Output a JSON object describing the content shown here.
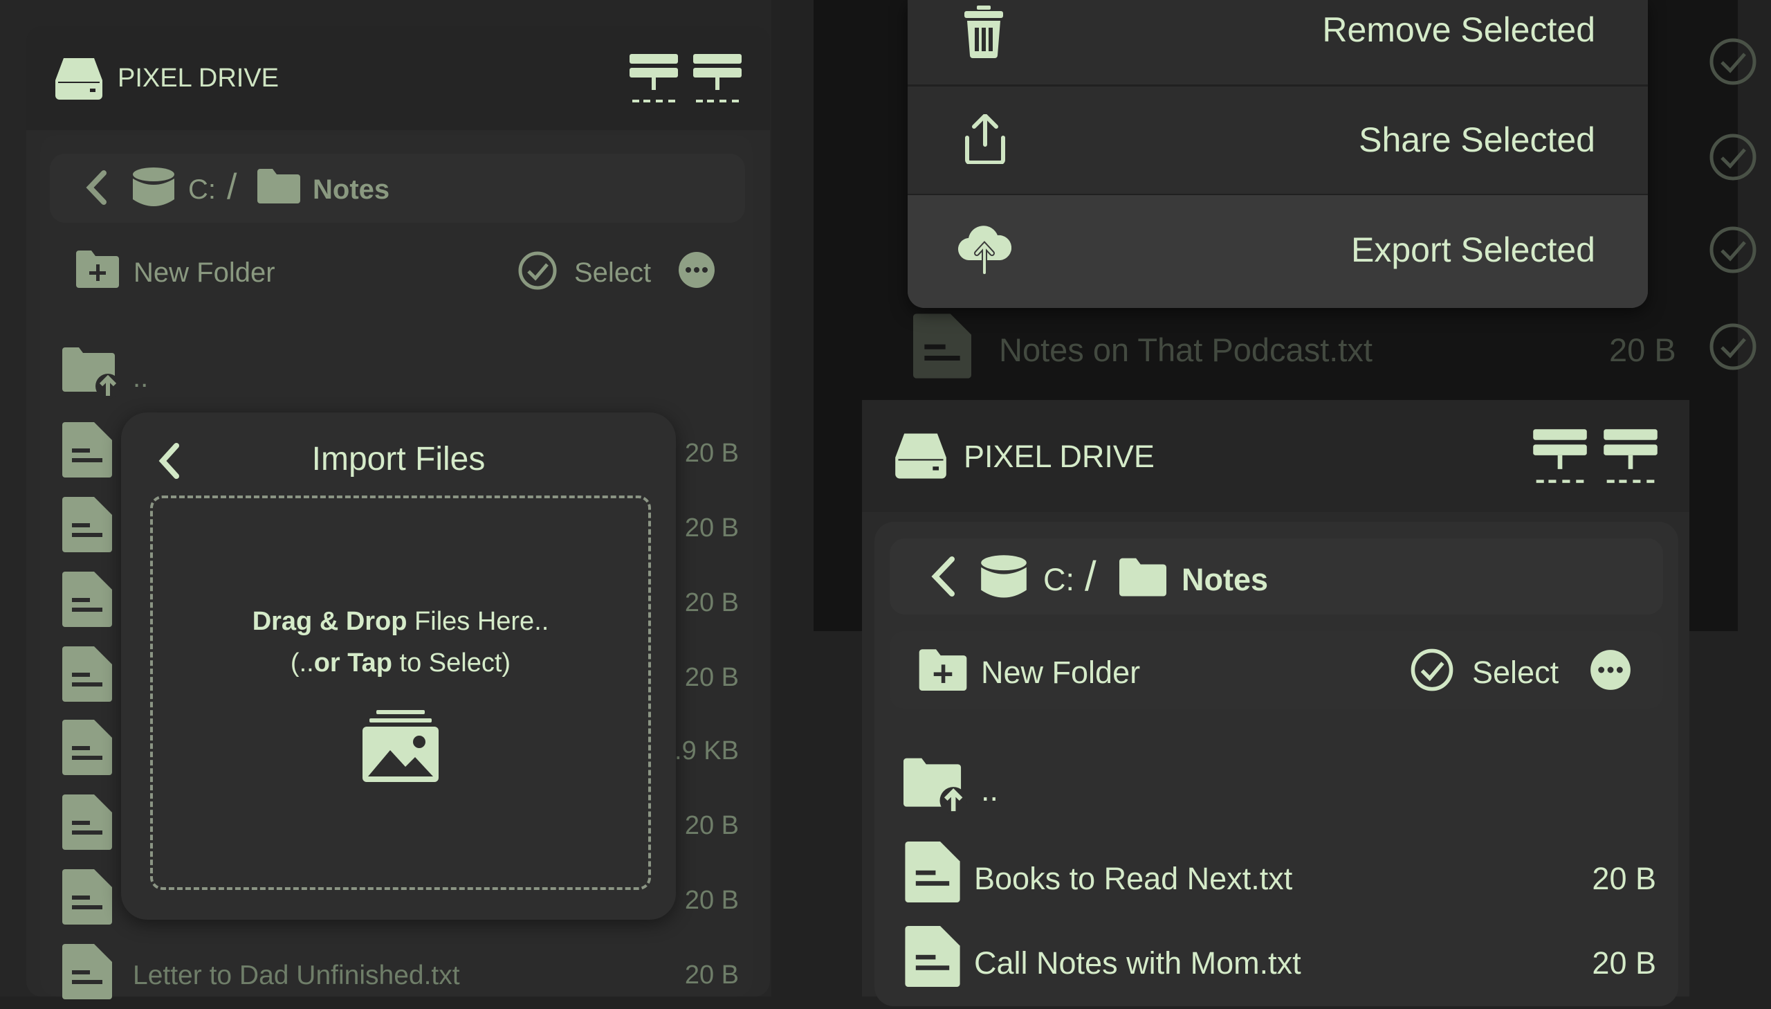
{
  "colors": {
    "accent": "#cfe5c3",
    "background": "#222222",
    "panel": "#2e2e2e"
  },
  "left_app": {
    "title": "PIXEL DRIVE",
    "breadcrumb": {
      "drive": "C:",
      "separator": "/",
      "folder": "Notes"
    },
    "toolbar": {
      "new_folder": "New Folder",
      "select": "Select"
    },
    "parent_label": "..",
    "file_sizes": [
      "20 B",
      "20 B",
      "20 B",
      "20 B",
      ".9 KB",
      "20 B",
      "20 B"
    ],
    "last_file": {
      "name": "Letter to Dad Unfinished.txt",
      "size": "20 B"
    }
  },
  "import_dialog": {
    "title": "Import Files",
    "drop_bold": "Drag & Drop",
    "drop_rest": " Files Here..",
    "tap_prefix": "(..",
    "tap_bold": "or Tap",
    "tap_rest": " to Select)"
  },
  "context_menu": {
    "items": [
      {
        "label": "Remove Selected",
        "icon": "trash-icon"
      },
      {
        "label": "Share Selected",
        "icon": "share-icon"
      },
      {
        "label": "Export Selected",
        "icon": "cloud-upload-icon"
      }
    ]
  },
  "right_top_app": {
    "visible_file": {
      "name": "Notes on That Podcast.txt",
      "size": "20 B"
    }
  },
  "right_app": {
    "title": "PIXEL DRIVE",
    "breadcrumb": {
      "drive": "C:",
      "separator": "/",
      "folder": "Notes"
    },
    "toolbar": {
      "new_folder": "New Folder",
      "select": "Select"
    },
    "parent_label": "..",
    "files": [
      {
        "name": "Books to Read Next.txt",
        "size": "20 B"
      },
      {
        "name": "Call Notes with Mom.txt",
        "size": "20 B"
      }
    ]
  }
}
